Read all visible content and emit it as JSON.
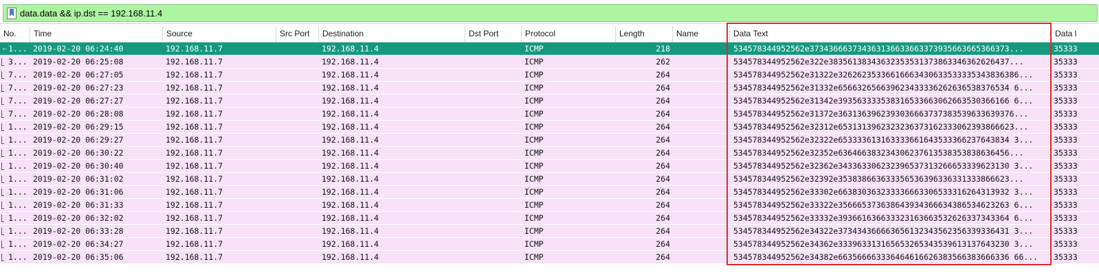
{
  "filter": {
    "value": "data.data && ip.dst == 192.168.11.4",
    "icon": "bookmark-icon"
  },
  "columns": [
    "No.",
    "Time",
    "Source",
    "Src Port",
    "Destination",
    "Dst Port",
    "Protocol",
    "Length",
    "Name",
    "Data Text",
    "Data l"
  ],
  "rows": [
    {
      "no": "1...",
      "time": "2019-02-20 06:24:40",
      "src": "192.168.11.7",
      "sport": "",
      "dst": "192.168.11.4",
      "dport": "",
      "proto": "ICMP",
      "len": "218",
      "name": "",
      "text": "534578344952562e373436663734363136633663373935663665366373...",
      "data": "35333",
      "selected": true
    },
    {
      "no": "3...",
      "time": "2019-02-20 06:25:08",
      "src": "192.168.11.7",
      "sport": "",
      "dst": "192.168.11.4",
      "dport": "",
      "proto": "ICMP",
      "len": "262",
      "name": "",
      "text": "534578344952562e322e38356138343632353531373863346362626437...",
      "data": "35333",
      "selected": false
    },
    {
      "no": "7...",
      "time": "2019-02-20 06:27:05",
      "src": "192.168.11.7",
      "sport": "",
      "dst": "192.168.11.4",
      "dport": "",
      "proto": "ICMP",
      "len": "264",
      "name": "",
      "text": "534578344952562e31322e32626235336616663430633533335343836386...",
      "data": "35333",
      "selected": false
    },
    {
      "no": "7...",
      "time": "2019-02-20 06:27:23",
      "src": "192.168.11.7",
      "sport": "",
      "dst": "192.168.11.4",
      "dport": "",
      "proto": "ICMP",
      "len": "264",
      "name": "",
      "text": "534578344952562e31332e656632656639623433336262636538376534 6...",
      "data": "35333",
      "selected": false
    },
    {
      "no": "7...",
      "time": "2019-02-20 06:27:27",
      "src": "192.168.11.7",
      "sport": "",
      "dst": "192.168.11.4",
      "dport": "",
      "proto": "ICMP",
      "len": "264",
      "name": "",
      "text": "534578344952562e31342e393563333538316533663062663530366166 6...",
      "data": "35333",
      "selected": false
    },
    {
      "no": "7...",
      "time": "2019-02-20 06:28:08",
      "src": "192.168.11.7",
      "sport": "",
      "dst": "192.168.11.4",
      "dport": "",
      "proto": "ICMP",
      "len": "264",
      "name": "",
      "text": "534578344952562e31372e3631363962393036663737383539633639376...",
      "data": "35333",
      "selected": false
    },
    {
      "no": "1...",
      "time": "2019-02-20 06:29:15",
      "src": "192.168.11.7",
      "sport": "",
      "dst": "192.168.11.4",
      "dport": "",
      "proto": "ICMP",
      "len": "264",
      "name": "",
      "text": "534578344952562e32312e6531313962323236373162333062393866623...",
      "data": "35333",
      "selected": false
    },
    {
      "no": "1...",
      "time": "2019-02-20 06:29:27",
      "src": "192.168.11.7",
      "sport": "",
      "dst": "192.168.11.4",
      "dport": "",
      "proto": "ICMP",
      "len": "264",
      "name": "",
      "text": "534578344952562e32322e653333613163333661643533366237643834 3...",
      "data": "35333",
      "selected": false
    },
    {
      "no": "1...",
      "time": "2019-02-20 06:30:22",
      "src": "192.168.11.7",
      "sport": "",
      "dst": "192.168.11.4",
      "dport": "",
      "proto": "ICMP",
      "len": "264",
      "name": "",
      "text": "534578344952562e32352e636466383234306237613538353838636456...",
      "data": "35333",
      "selected": false
    },
    {
      "no": "1...",
      "time": "2019-02-20 06:30:40",
      "src": "192.168.11.7",
      "sport": "",
      "dst": "192.168.11.4",
      "dport": "",
      "proto": "ICMP",
      "len": "264",
      "name": "",
      "text": "534578344952562e32362e343363306232396537313266653339623130 3...",
      "data": "35333",
      "selected": false
    },
    {
      "no": "1...",
      "time": "2019-02-20 06:31:02",
      "src": "192.168.11.7",
      "sport": "",
      "dst": "192.168.11.4",
      "dport": "",
      "proto": "ICMP",
      "len": "264",
      "name": "",
      "text": "534578344952562e32392e353838663633356536396336331333866623...",
      "data": "35333",
      "selected": false
    },
    {
      "no": "1...",
      "time": "2019-02-20 06:31:06",
      "src": "192.168.11.7",
      "sport": "",
      "dst": "192.168.11.4",
      "dport": "",
      "proto": "ICMP",
      "len": "264",
      "name": "",
      "text": "534578344952562e33302e663830363233336663306533316264313932 3...",
      "data": "35333",
      "selected": false
    },
    {
      "no": "1...",
      "time": "2019-02-20 06:31:33",
      "src": "192.168.11.7",
      "sport": "",
      "dst": "192.168.11.4",
      "dport": "",
      "proto": "ICMP",
      "len": "264",
      "name": "",
      "text": "534578344952562e33322e356665373638643934366634386534623263 6...",
      "data": "35333",
      "selected": false
    },
    {
      "no": "1...",
      "time": "2019-02-20 06:32:02",
      "src": "192.168.11.7",
      "sport": "",
      "dst": "192.168.11.4",
      "dport": "",
      "proto": "ICMP",
      "len": "264",
      "name": "",
      "text": "534578344952562e33332e393661636633323163663532626337343364 6...",
      "data": "35333",
      "selected": false
    },
    {
      "no": "1...",
      "time": "2019-02-20 06:33:28",
      "src": "192.168.11.7",
      "sport": "",
      "dst": "192.168.11.4",
      "dport": "",
      "proto": "ICMP",
      "len": "264",
      "name": "",
      "text": "534578344952562e34322e373434366663656132343562356339336431 3...",
      "data": "35333",
      "selected": false
    },
    {
      "no": "1...",
      "time": "2019-02-20 06:34:27",
      "src": "192.168.11.7",
      "sport": "",
      "dst": "192.168.11.4",
      "dport": "",
      "proto": "ICMP",
      "len": "264",
      "name": "",
      "text": "534578344952562e34362e333963313165653265343539613137643230 3...",
      "data": "35333",
      "selected": false
    },
    {
      "no": "1...",
      "time": "2019-02-20 06:35:06",
      "src": "192.168.11.7",
      "sport": "",
      "dst": "192.168.11.4",
      "dport": "",
      "proto": "ICMP",
      "len": "264",
      "name": "",
      "text": "534578344952562e34382e663566663336464616626383566383666336 66...",
      "data": "35333",
      "selected": false
    }
  ],
  "colors": {
    "filter_bg": "#aef5a2",
    "selected_row": "#139a7e",
    "row_bg": "#f7e2f8",
    "highlight_box": "#e0282b"
  }
}
